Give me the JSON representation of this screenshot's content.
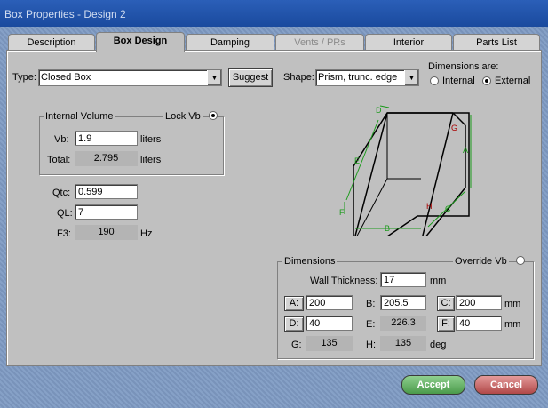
{
  "window": {
    "title": "Box Properties - Design 2"
  },
  "tabs": [
    {
      "label": "Description"
    },
    {
      "label": "Box Design"
    },
    {
      "label": "Damping"
    },
    {
      "label": "Vents / PRs"
    },
    {
      "label": "Interior"
    },
    {
      "label": "Parts List"
    }
  ],
  "type": {
    "label": "Type:",
    "value": "Closed Box",
    "suggest_label": "Suggest"
  },
  "shape": {
    "label": "Shape:",
    "value": "Prism, trunc. edge"
  },
  "dimensions_are": {
    "label": "Dimensions are:",
    "internal_label": "Internal",
    "external_label": "External",
    "selected": "External"
  },
  "internal_volume": {
    "group_label": "Internal Volume",
    "lock_label": "Lock Vb",
    "vb_label": "Vb:",
    "vb_value": "1.9",
    "vb_unit": "liters",
    "total_label": "Total:",
    "total_value": "2.795",
    "total_unit": "liters"
  },
  "params": {
    "qtc_label": "Qtc:",
    "qtc_value": "0.599",
    "ql_label": "QL:",
    "ql_value": "7",
    "f3_label": "F3:",
    "f3_value": "190",
    "f3_unit": "Hz"
  },
  "diagram": {
    "labels": {
      "a": "A",
      "b": "B",
      "c": "C",
      "d": "D",
      "e": "E",
      "f": "F",
      "g": "G",
      "h": "H"
    }
  },
  "dimensions": {
    "group_label": "Dimensions",
    "override_label": "Override Vb",
    "wall_label": "Wall Thickness:",
    "wall_value": "17",
    "wall_unit": "mm",
    "a_label": "A:",
    "a_value": "200",
    "b_label": "B:",
    "b_value": "205.5",
    "c_label": "C:",
    "c_value": "200",
    "c_unit": "mm",
    "d_label": "D:",
    "d_value": "40",
    "e_label": "E:",
    "e_value": "226.3",
    "f_label": "F:",
    "f_value": "40",
    "f_unit": "mm",
    "g_label": "G:",
    "g_value": "135",
    "h_label": "H:",
    "h_value": "135",
    "h_unit": "deg"
  },
  "footer": {
    "accept_label": "Accept",
    "cancel_label": "Cancel"
  },
  "colors": {
    "accept": "#5aa55a",
    "cancel": "#c85a5a",
    "dimension_lines": "#1a9a1a",
    "highlight_letters": "#aa0000"
  }
}
